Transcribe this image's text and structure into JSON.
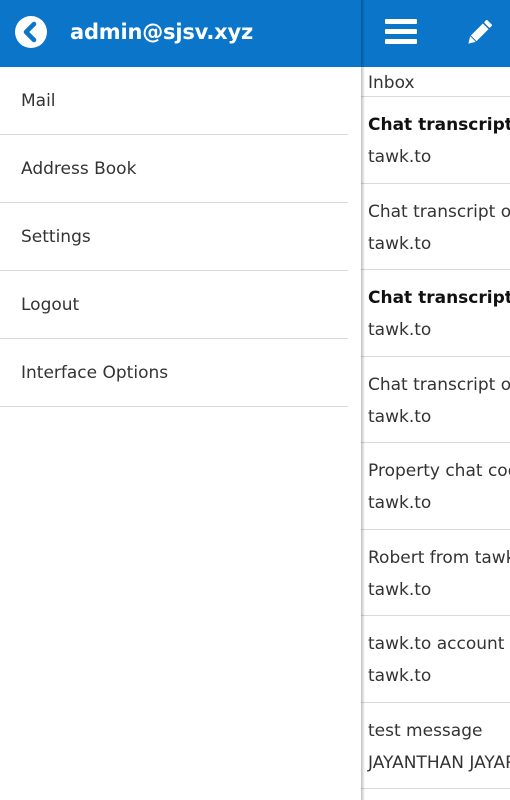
{
  "drawer": {
    "account": "admin@sjsv.xyz",
    "menu": [
      {
        "label": "Mail"
      },
      {
        "label": "Address Book"
      },
      {
        "label": "Settings"
      },
      {
        "label": "Logout"
      },
      {
        "label": "Interface Options"
      }
    ]
  },
  "pane": {
    "folder": "Inbox",
    "messages": [
      {
        "subject": "Chat transcript on",
        "sender": "tawk.to",
        "unread": true
      },
      {
        "subject": "Chat transcript on",
        "sender": "tawk.to",
        "unread": false
      },
      {
        "subject": "Chat transcript on",
        "sender": "tawk.to",
        "unread": true
      },
      {
        "subject": "Chat transcript on",
        "sender": "tawk.to",
        "unread": false
      },
      {
        "subject": "Property chat cod",
        "sender": "tawk.to",
        "unread": false
      },
      {
        "subject": "Robert from tawk",
        "sender": "tawk.to",
        "unread": false
      },
      {
        "subject": "tawk.to account a",
        "sender": "tawk.to",
        "unread": false
      },
      {
        "subject": "test message",
        "sender": "JAYANTHAN JAYAR",
        "unread": false
      }
    ]
  },
  "icons": {
    "back": "chevron-left-circle-icon",
    "menu": "hamburger-menu-icon",
    "compose": "pencil-icon"
  },
  "colors": {
    "header": "#0a75c9",
    "divider": "#d9d9d9"
  }
}
